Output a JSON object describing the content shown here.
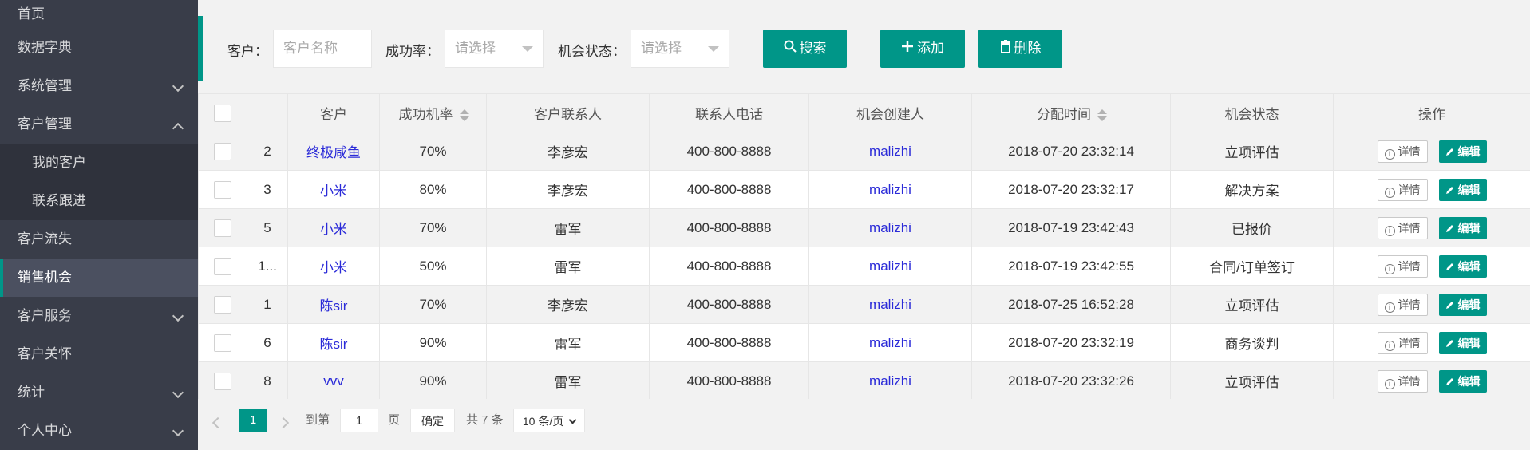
{
  "sidebar": {
    "items": [
      {
        "label": "首页"
      },
      {
        "label": "数据字典"
      },
      {
        "label": "系统管理"
      },
      {
        "label": "客户管理"
      },
      {
        "label": "我的客户"
      },
      {
        "label": "联系跟进"
      },
      {
        "label": "客户流失"
      },
      {
        "label": "销售机会"
      },
      {
        "label": "客户服务"
      },
      {
        "label": "客户关怀"
      },
      {
        "label": "统计"
      },
      {
        "label": "个人中心"
      }
    ]
  },
  "filters": {
    "customer_label": "客户：",
    "customer_placeholder": "客户名称",
    "rate_label": "成功率：",
    "rate_select": "请选择",
    "status_label": "机会状态：",
    "status_select": "请选择"
  },
  "buttons": {
    "search": "搜索",
    "add": "添加",
    "delete": "删除"
  },
  "table": {
    "headers": [
      "",
      "客户",
      "成功机率",
      "客户联系人",
      "联系人电话",
      "机会创建人",
      "分配时间",
      "机会状态",
      "操作"
    ],
    "detail_label": "详情",
    "edit_label": "编辑",
    "rows": [
      {
        "id": "2",
        "customer": "终极咸鱼",
        "rate": "70%",
        "contact": "李彦宏",
        "phone": "400-800-8888",
        "creator": "malizhi",
        "time": "2018-07-20 23:32:14",
        "status": "立项评估"
      },
      {
        "id": "3",
        "customer": "小米",
        "rate": "80%",
        "contact": "李彦宏",
        "phone": "400-800-8888",
        "creator": "malizhi",
        "time": "2018-07-20 23:32:17",
        "status": "解决方案"
      },
      {
        "id": "5",
        "customer": "小米",
        "rate": "70%",
        "contact": "雷军",
        "phone": "400-800-8888",
        "creator": "malizhi",
        "time": "2018-07-19 23:42:43",
        "status": "已报价"
      },
      {
        "id": "1...",
        "customer": "小米",
        "rate": "50%",
        "contact": "雷军",
        "phone": "400-800-8888",
        "creator": "malizhi",
        "time": "2018-07-19 23:42:55",
        "status": "合同/订单签订"
      },
      {
        "id": "1",
        "customer": "陈sir",
        "rate": "70%",
        "contact": "李彦宏",
        "phone": "400-800-8888",
        "creator": "malizhi",
        "time": "2018-07-25 16:52:28",
        "status": "立项评估"
      },
      {
        "id": "6",
        "customer": "陈sir",
        "rate": "90%",
        "contact": "雷军",
        "phone": "400-800-8888",
        "creator": "malizhi",
        "time": "2018-07-20 23:32:19",
        "status": "商务谈判"
      },
      {
        "id": "8",
        "customer": "vvv",
        "rate": "90%",
        "contact": "雷军",
        "phone": "400-800-8888",
        "creator": "malizhi",
        "time": "2018-07-20 23:32:26",
        "status": "立项评估"
      }
    ]
  },
  "pager": {
    "current": "1",
    "goto_label": "到第",
    "goto_value": "1",
    "page_unit": "页",
    "confirm": "确定",
    "total": "共 7 条",
    "page_size": "10 条/页"
  },
  "colors": {
    "accent": "#009688",
    "sidebar_bg": "#393d49",
    "link": "#2b2bd8"
  }
}
